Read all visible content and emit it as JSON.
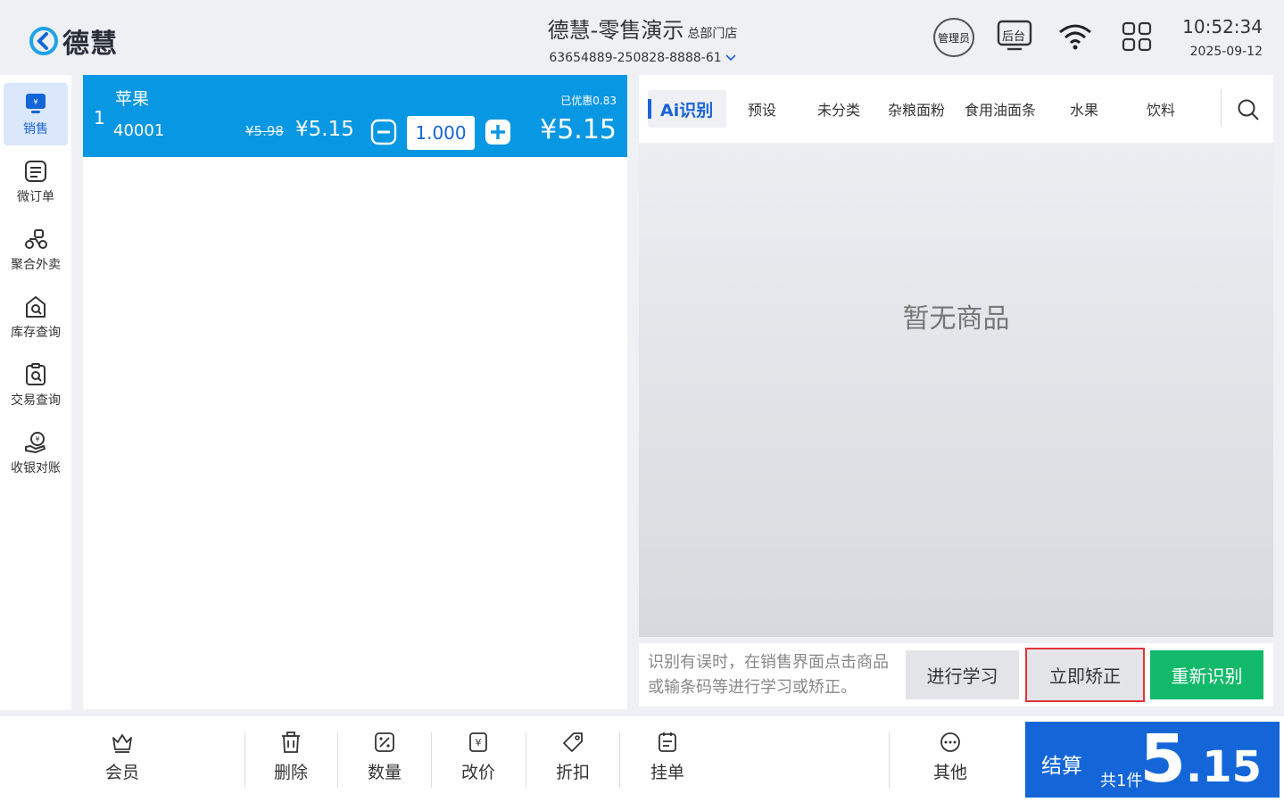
{
  "header": {
    "logo_text": "德慧",
    "store_title": "德慧-零售演示",
    "store_branch": "总部门店",
    "store_code": "63654889-250828-8888-61",
    "admin_label": "管理员",
    "backend_label": "后台",
    "time": "10:52:34",
    "date": "2025-09-12"
  },
  "sidebar": {
    "items": [
      {
        "label": "销售",
        "icon": "sales-monitor-icon",
        "active": true
      },
      {
        "label": "微订单",
        "icon": "order-list-icon"
      },
      {
        "label": "聚合外卖",
        "icon": "delivery-scooter-icon"
      },
      {
        "label": "库存查询",
        "icon": "inventory-search-icon"
      },
      {
        "label": "交易查询",
        "icon": "transaction-search-icon"
      },
      {
        "label": "收银对账",
        "icon": "reconcile-coin-icon"
      }
    ]
  },
  "cart": {
    "items": [
      {
        "index": "1",
        "name": "苹果",
        "code": "40001",
        "discount": "已优惠0.83",
        "original_price": "¥5.98",
        "unit_price": "¥5.15",
        "quantity": "1.000",
        "total": "¥5.15"
      }
    ]
  },
  "goods": {
    "tabs": [
      "Ai识别",
      "预设",
      "未分类",
      "杂粮面粉",
      "食用油面条",
      "水果",
      "饮料"
    ],
    "active_tab": "Ai识别",
    "empty_text": "暂无商品"
  },
  "ai_bar": {
    "hint": "识别有误时，在销售界面点击商品或输条码等进行学习或矫正。",
    "learn_label": "进行学习",
    "correct_label": "立即矫正",
    "redo_label": "重新识别"
  },
  "bottom": {
    "functions": [
      {
        "label": "会员",
        "icon": "crown-icon"
      },
      {
        "label": "删除",
        "icon": "trash-icon"
      },
      {
        "label": "数量",
        "icon": "percent-box-icon"
      },
      {
        "label": "改价",
        "icon": "yen-tag-icon"
      },
      {
        "label": "折扣",
        "icon": "price-tag-icon"
      },
      {
        "label": "挂单",
        "icon": "clipboard-icon"
      },
      {
        "label": "其他",
        "icon": "more-dots-icon"
      }
    ],
    "checkout": {
      "label": "结算",
      "count": "共1件",
      "amount_int": "5",
      "amount_dec": ".15"
    }
  },
  "colors": {
    "brand_blue": "#1466d8",
    "cart_row_blue": "#0897e2",
    "green": "#13b96b",
    "highlight_red": "#e0343b"
  }
}
